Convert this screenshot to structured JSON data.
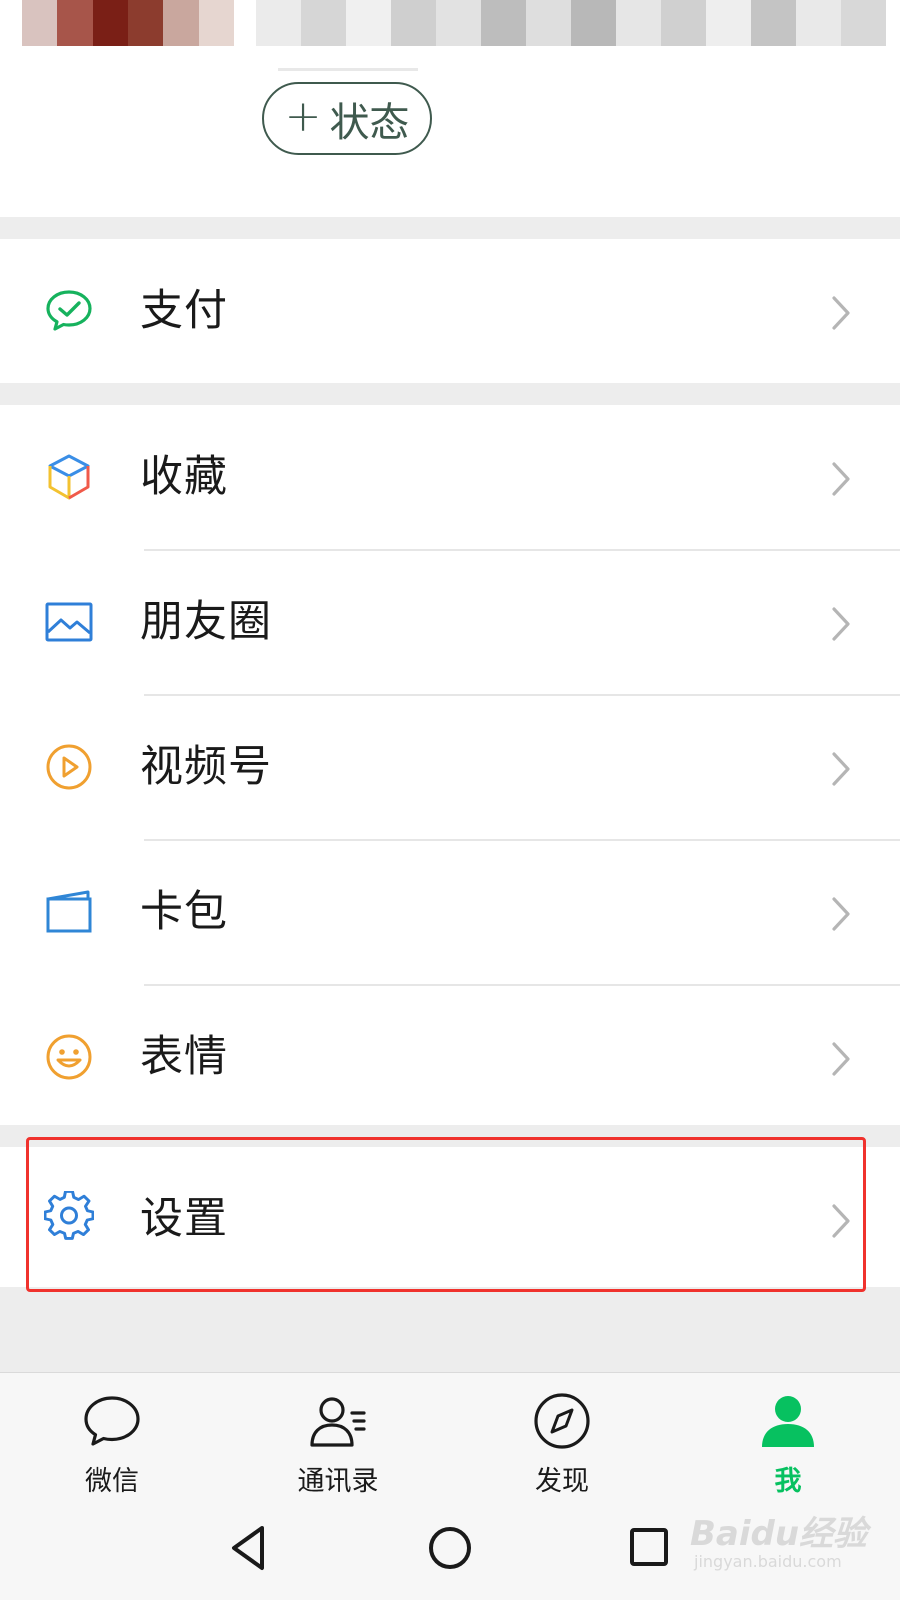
{
  "header": {
    "status_button": {
      "plus": "+",
      "label": "状态"
    }
  },
  "menu": {
    "pay": {
      "label": "支付",
      "icon": "wechat-pay-icon"
    },
    "favorites": {
      "label": "收藏",
      "icon": "cube-icon"
    },
    "moments": {
      "label": "朋友圈",
      "icon": "image-icon"
    },
    "channels": {
      "label": "视频号",
      "icon": "play-circle-icon"
    },
    "cards": {
      "label": "卡包",
      "icon": "card-wallet-icon"
    },
    "stickers": {
      "label": "表情",
      "icon": "smiley-icon"
    },
    "settings": {
      "label": "设置",
      "icon": "gear-icon",
      "highlighted": true
    }
  },
  "tabbar": {
    "tabs": [
      {
        "label": "微信",
        "icon": "chat-bubble-icon",
        "active": false
      },
      {
        "label": "通讯录",
        "icon": "contacts-icon",
        "active": false
      },
      {
        "label": "发现",
        "icon": "compass-icon",
        "active": false
      },
      {
        "label": "我",
        "icon": "person-icon",
        "active": true
      }
    ]
  },
  "system_nav": [
    "back",
    "home",
    "recents"
  ],
  "watermark": {
    "brand": "Baidu经验",
    "url": "jingyan.baidu.com"
  },
  "colors": {
    "accent_green": "#07c160",
    "highlight_red": "#f0322d",
    "background": "#ededed"
  }
}
